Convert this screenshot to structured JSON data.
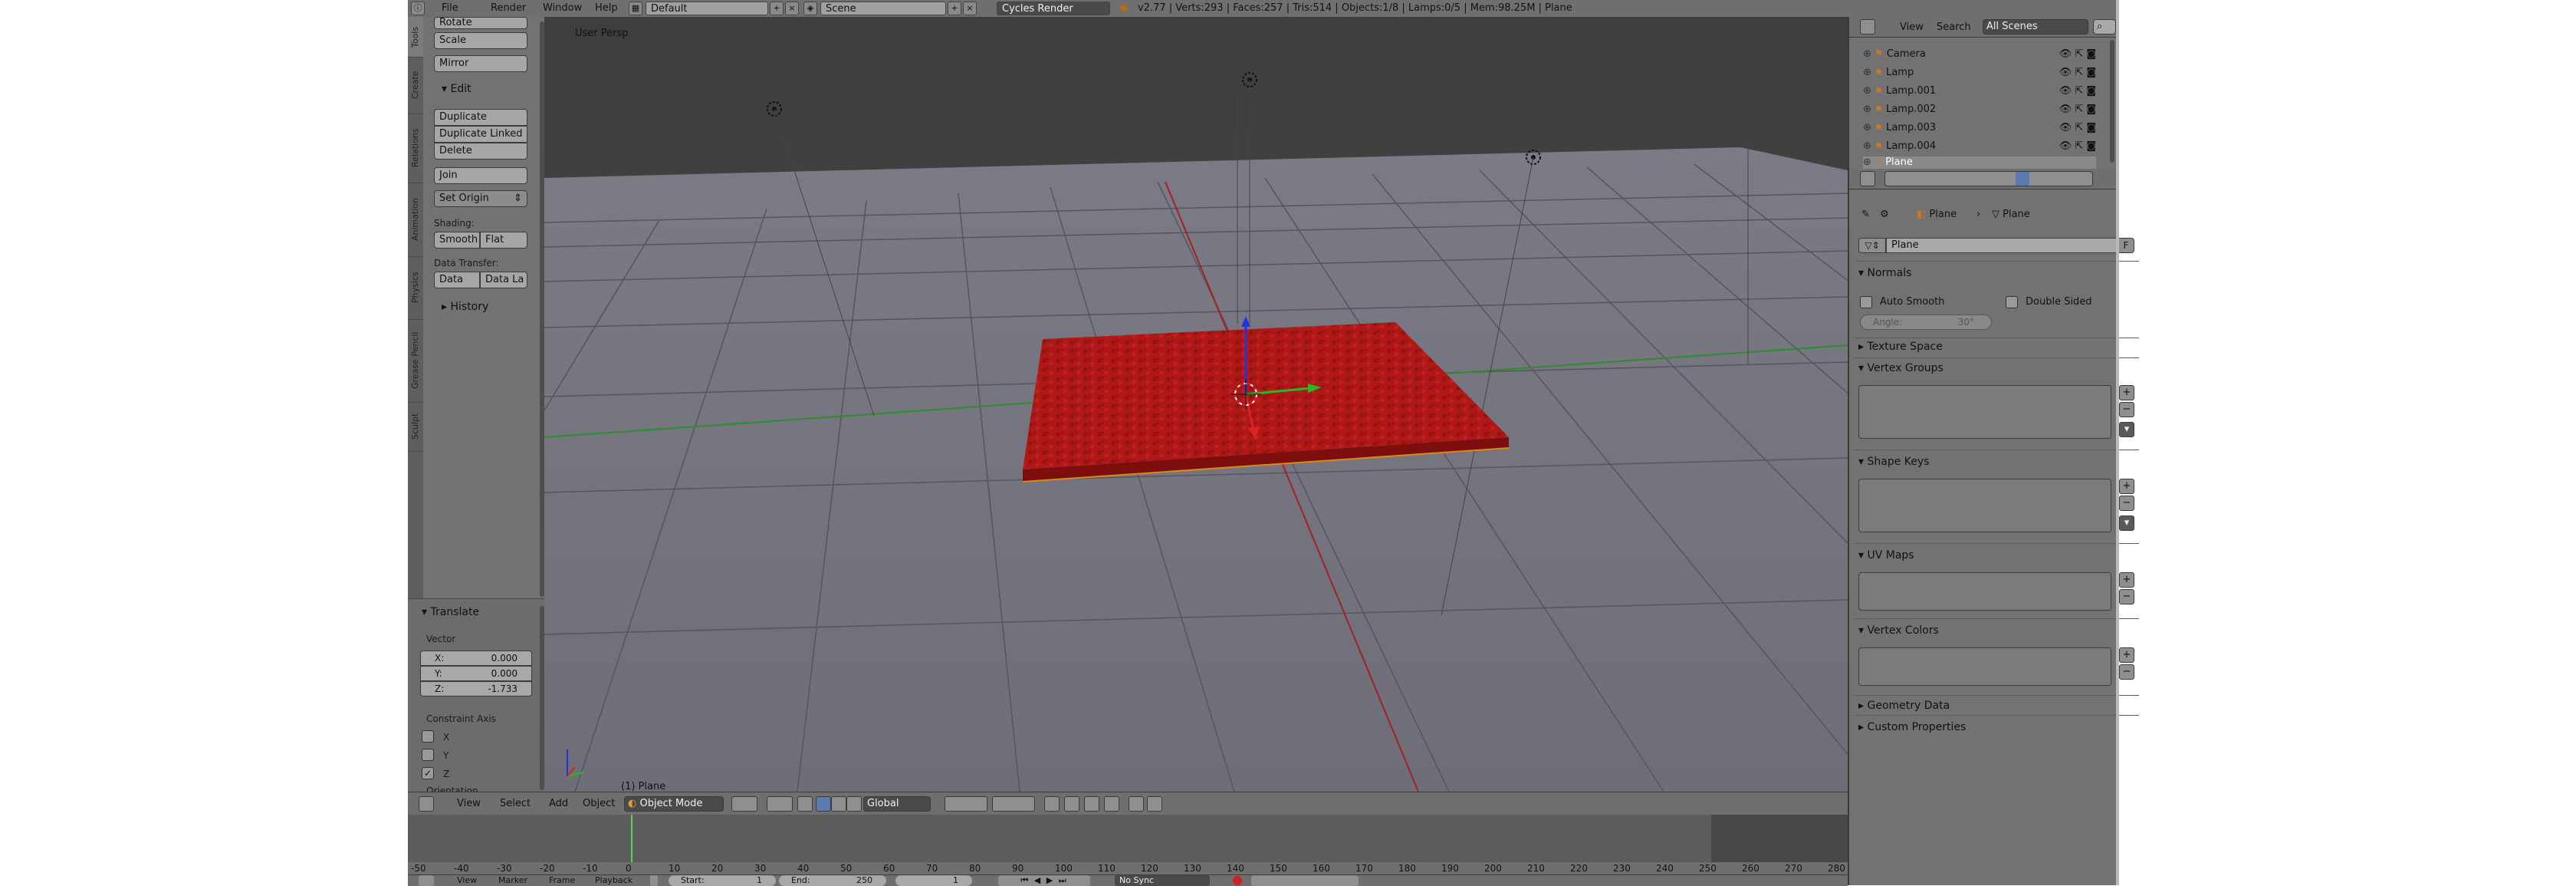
{
  "topbar": {
    "menus": [
      "File",
      "Render",
      "Window",
      "Help"
    ],
    "screen_layout": "Default",
    "scene": "Scene",
    "render_engine": "Cycles Render",
    "stats": "v2.77 | Verts:293 | Faces:257 | Tris:514 | Objects:1/8 | Lamps:0/5 | Mem:98.25M | Plane"
  },
  "toolshelf": {
    "tabs": [
      "Tools",
      "Create",
      "Relations",
      "Animation",
      "Physics",
      "Grease Pencil",
      "Sculpt"
    ],
    "transform_buttons": [
      "Rotate",
      "Scale",
      "Mirror"
    ],
    "edit_heading": "Edit",
    "edit_buttons": [
      "Duplicate",
      "Duplicate Linked",
      "Delete"
    ],
    "join": "Join",
    "set_origin": "Set Origin",
    "shading_label": "Shading:",
    "smooth": "Smooth",
    "flat": "Flat",
    "data_transfer_label": "Data Transfer:",
    "data": "Data",
    "data_layout": "Data La",
    "history": "History"
  },
  "redo_panel": {
    "title": "Translate",
    "vector_label": "Vector",
    "x_label": "X:",
    "x_value": "0.000",
    "y_label": "Y:",
    "y_value": "0.000",
    "z_label": "Z:",
    "z_value": "-1.733",
    "constraint_label": "Constraint Axis",
    "axis_x": "X",
    "axis_y": "Y",
    "axis_z": "Z",
    "axis_x_checked": false,
    "axis_y_checked": false,
    "axis_z_checked": true,
    "orientation_label": "Orientation"
  },
  "viewport": {
    "view_name": "User Persp",
    "object_label": "(1) Plane",
    "plane_color": "#b01818",
    "x_axis_color": "#a52020",
    "y_axis_color": "#2e8b2e"
  },
  "viewport_header": {
    "menus": [
      "View",
      "Select",
      "Add",
      "Object"
    ],
    "mode": "Object Mode",
    "orientation": "Global"
  },
  "timeline": {
    "current_frame": 0,
    "ticks": [
      -50,
      -40,
      -30,
      -20,
      -10,
      0,
      10,
      20,
      30,
      40,
      50,
      60,
      70,
      80,
      90,
      100,
      110,
      120,
      130,
      140,
      150,
      160,
      170,
      180,
      190,
      200,
      210,
      220,
      230,
      240,
      250,
      260,
      270,
      280
    ],
    "footer_menus": [
      "View",
      "Marker",
      "Frame",
      "Playback"
    ],
    "start_label": "Start:",
    "start_value": "1",
    "end_label": "End:",
    "end_value": "250",
    "frame_value": "1",
    "sync": "No Sync"
  },
  "outliner": {
    "menus": [
      "View",
      "Search"
    ],
    "filter": "All Scenes",
    "items": [
      "Camera",
      "Lamp",
      "Lamp.001",
      "Lamp.002",
      "Lamp.003",
      "Lamp.004",
      "Plane"
    ],
    "selected_item": "Plane"
  },
  "properties": {
    "breadcrumb": [
      "Plane",
      "Plane"
    ],
    "datablock_name": "Plane",
    "fake_user": "F",
    "sections": {
      "normals": "Normals",
      "auto_smooth": "Auto Smooth",
      "double_sided": "Double Sided",
      "angle_label": "Angle:",
      "angle_value": "30°",
      "texture_space": "Texture Space",
      "vertex_groups": "Vertex Groups",
      "shape_keys": "Shape Keys",
      "uv_maps": "UV Maps",
      "vertex_colors": "Vertex Colors",
      "geometry_data": "Geometry Data",
      "custom_properties": "Custom Properties"
    }
  }
}
